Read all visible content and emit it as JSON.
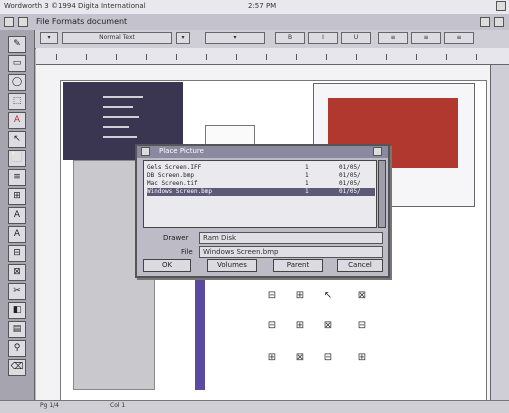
{
  "screen": {
    "title": "Wordworth 3 ©1994 Digita International",
    "clock": "2:57 PM"
  },
  "window": {
    "title": "File Formats document",
    "style_selector": "Normal Text"
  },
  "toolbar": {
    "button_labels": [
      "B",
      "I",
      "U",
      "≡",
      "≡",
      "≡"
    ]
  },
  "toolbox": {
    "tools": [
      "✎",
      "▭",
      "◯",
      "⬚",
      "A",
      "↖",
      "⬜",
      "≡",
      "⊞",
      "A",
      "A",
      "⊟",
      "⊠",
      "✂",
      "◧",
      "▤",
      "⚲",
      "⌫"
    ]
  },
  "dialog": {
    "title": "Place Picture",
    "files": [
      {
        "name": "Gels Screen.IFF",
        "size": "1",
        "date": "01/05/"
      },
      {
        "name": "DB Screen.bmp",
        "size": "1",
        "date": "01/05/"
      },
      {
        "name": "Mac Screen.tif",
        "size": "1",
        "date": "01/05/"
      },
      {
        "name": "Windows Screen.bmp",
        "size": "1",
        "date": "01/05/"
      }
    ],
    "drawer_label": "Drawer",
    "drawer_value": "Ram Disk",
    "file_label": "File",
    "file_value": "Windows Screen.bmp",
    "buttons": {
      "ok": "OK",
      "volumes": "Volumes",
      "parent": "Parent",
      "cancel": "Cancel"
    }
  },
  "icon_grid": [
    "⊟",
    "⊞",
    "↖",
    "⊠",
    "⊟",
    "⊞",
    "⊠",
    "⊟",
    "⊞",
    "⊠",
    "⊟",
    "⊞"
  ],
  "status": {
    "left": "Pg 1/4",
    "mid": "Col 1"
  },
  "colors": {
    "accent_red": "#b0382f",
    "dialog_title": "#8b89a0",
    "selection": "#5d5a78"
  }
}
